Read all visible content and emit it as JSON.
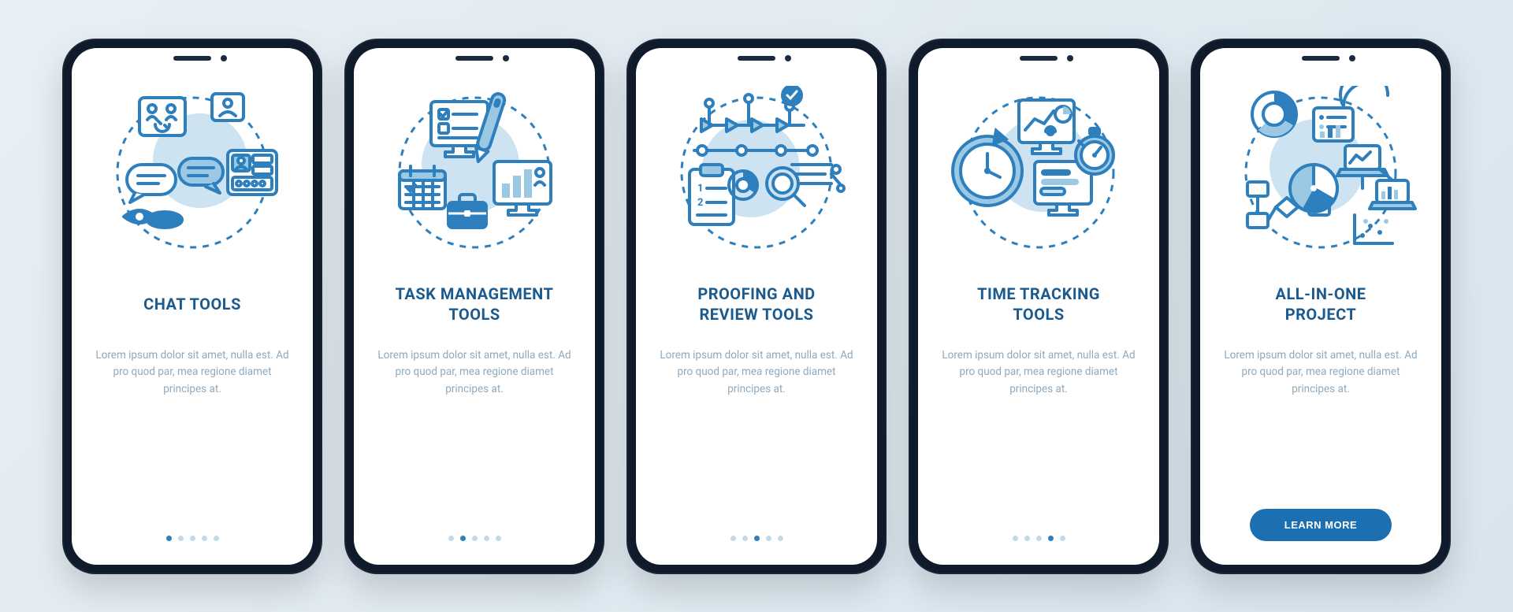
{
  "screens": [
    {
      "icon_name": "chat-tools-icon",
      "title": "CHAT TOOLS",
      "body": "Lorem ipsum dolor sit amet, nulla est. Ad pro quod par, mea regione diamet principes at.",
      "has_cta": false
    },
    {
      "icon_name": "task-management-tools-icon",
      "title": "TASK MANAGEMENT\nTOOLS",
      "body": "Lorem ipsum dolor sit amet, nulla est. Ad pro quod par, mea regione diamet principes at.",
      "has_cta": false
    },
    {
      "icon_name": "proofing-review-tools-icon",
      "title": "PROOFING AND\nREVIEW TOOLS",
      "body": "Lorem ipsum dolor sit amet, nulla est. Ad pro quod par, mea regione diamet principes at.",
      "has_cta": false
    },
    {
      "icon_name": "time-tracking-tools-icon",
      "title": "TIME TRACKING\nTOOLS",
      "body": "Lorem ipsum dolor sit amet, nulla est. Ad pro quod par, mea regione diamet principes at.",
      "has_cta": false
    },
    {
      "icon_name": "all-in-one-project-icon",
      "title": "ALL-IN-ONE\nPROJECT",
      "body": "Lorem ipsum dolor sit amet, nulla est. Ad pro quod par, mea regione diamet principes at.",
      "has_cta": true
    }
  ],
  "cta_label": "LEARN MORE",
  "page_count": 5,
  "colors": {
    "primary": "#2d7fbd",
    "title": "#1b5a8e",
    "body": "#8fa9bd",
    "bg_light": "#e8eff4"
  }
}
